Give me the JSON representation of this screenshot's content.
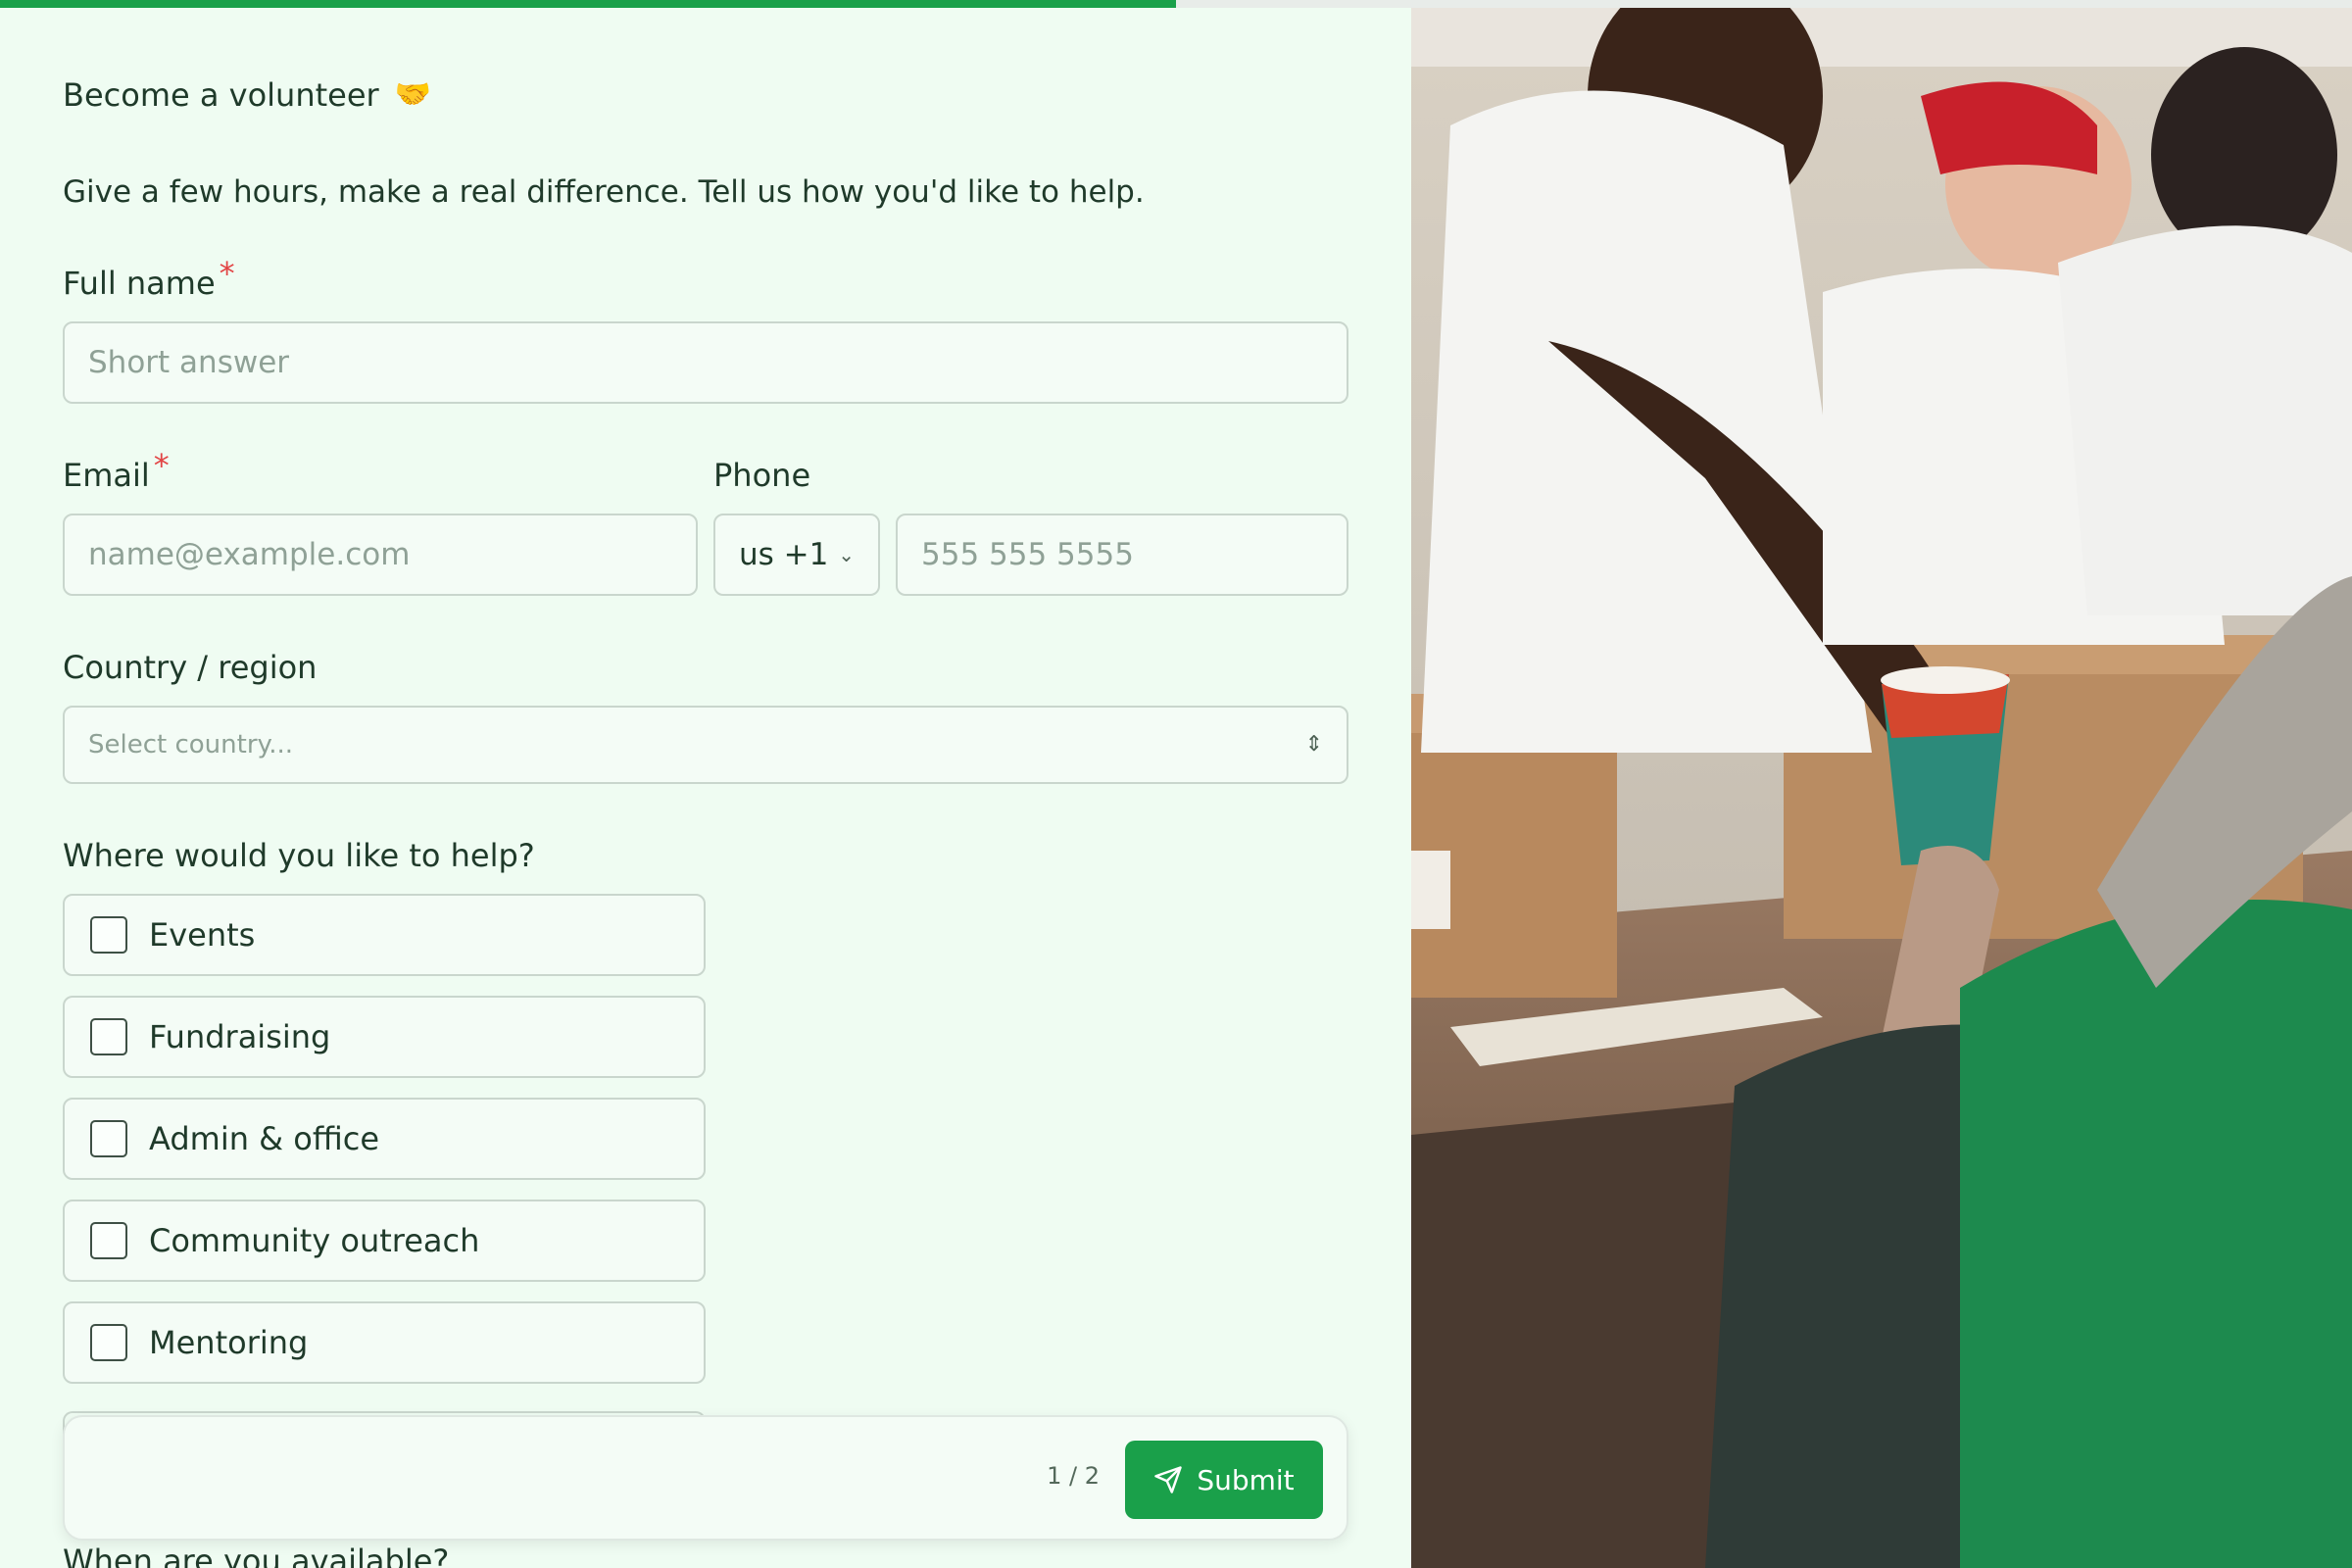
{
  "progress": {
    "fraction": 0.5
  },
  "form": {
    "title": "Become a volunteer",
    "title_emoji": "🤝",
    "subtitle": "Give a few hours, make a real difference. Tell us how you'd like to help.",
    "full_name": {
      "label": "Full name",
      "required": "*",
      "placeholder": "Short answer"
    },
    "email": {
      "label": "Email",
      "required": "*",
      "placeholder": "name@example.com"
    },
    "phone": {
      "label": "Phone",
      "country_code": "us +1",
      "placeholder": "555 555 5555"
    },
    "country": {
      "label": "Country / region",
      "placeholder": "Select country..."
    },
    "help": {
      "label": "Where would you like to help?",
      "options": [
        "Events",
        "Fundraising",
        "Admin & office",
        "Community outreach",
        "Mentoring"
      ]
    },
    "availability_label": "When are you available?"
  },
  "footer": {
    "page": "1 / 2",
    "submit_label": "Submit"
  },
  "colors": {
    "accent": "#1aa04a",
    "required": "#e24545",
    "background": "#effcf2"
  },
  "icons": [
    "handshake-icon",
    "chevron-down-icon",
    "updown-icon",
    "send-icon"
  ]
}
